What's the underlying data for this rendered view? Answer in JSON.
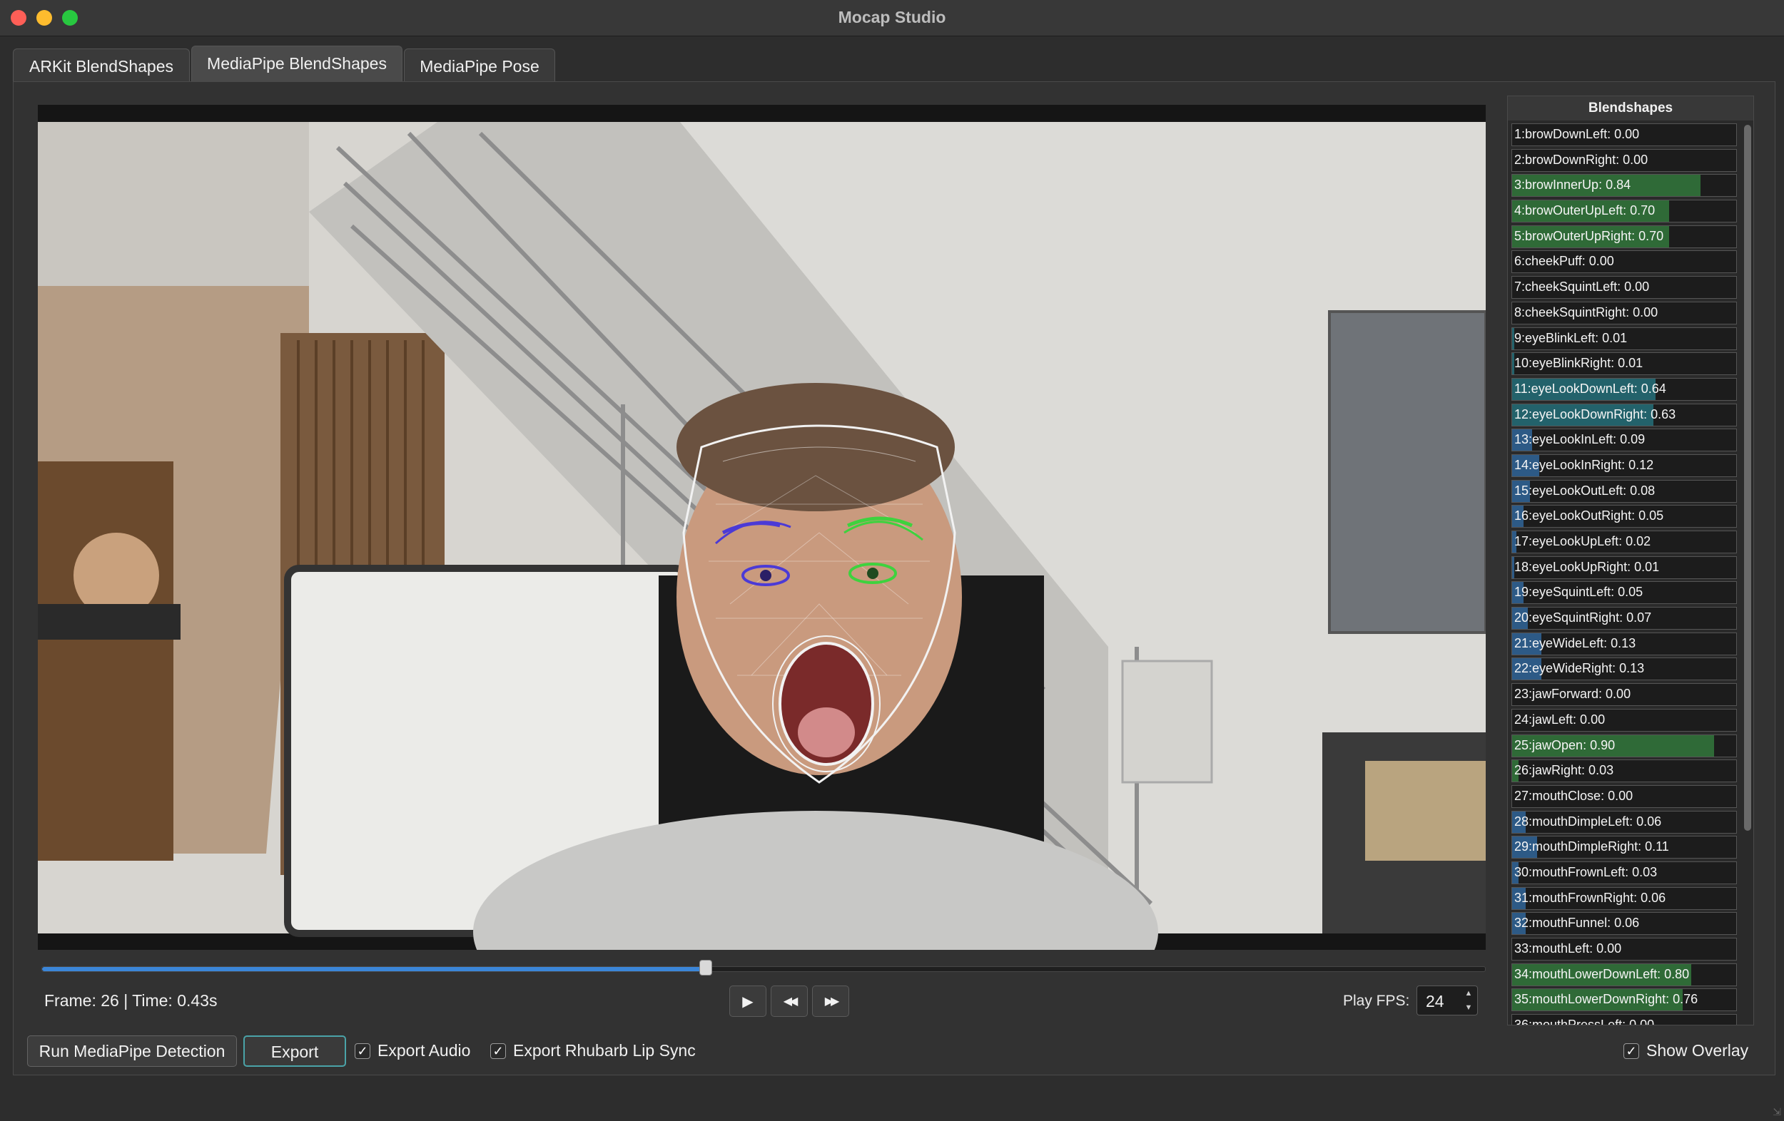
{
  "window": {
    "title": "Mocap Studio"
  },
  "tabs": [
    {
      "label": "ARKit BlendShapes",
      "active": false
    },
    {
      "label": "MediaPipe BlendShapes",
      "active": true
    },
    {
      "label": "MediaPipe Pose",
      "active": false
    }
  ],
  "video": {
    "description_icon": "face-mesh-overlay"
  },
  "timeline": {
    "progress": 0.46
  },
  "status": {
    "frame_label": "Frame: 26 | Time: 0.43s"
  },
  "controls": {
    "play_icon": "play-icon",
    "rewind_icon": "rewind-icon",
    "forward_icon": "fast-forward-icon",
    "fps_label": "Play FPS:",
    "fps_value": "24"
  },
  "actions": {
    "run_label": "Run MediaPipe Detection",
    "export_label": "Export",
    "export_audio_label": "Export Audio",
    "export_audio_checked": true,
    "export_rhubarb_label": "Export Rhubarb Lip Sync",
    "export_rhubarb_checked": true,
    "show_overlay_label": "Show Overlay",
    "show_overlay_checked": true
  },
  "blendshapes": {
    "header": "Blendshapes",
    "colors": {
      "green": "#2f6a37",
      "teal": "#23626b",
      "blue": "#2d5a86"
    },
    "items": [
      {
        "label": "1:browDownLeft: 0.00",
        "value": 0.0,
        "color": "green"
      },
      {
        "label": "2:browDownRight: 0.00",
        "value": 0.0,
        "color": "green"
      },
      {
        "label": "3:browInnerUp: 0.84",
        "value": 0.84,
        "color": "green"
      },
      {
        "label": "4:browOuterUpLeft: 0.70",
        "value": 0.7,
        "color": "green"
      },
      {
        "label": "5:browOuterUpRight: 0.70",
        "value": 0.7,
        "color": "green"
      },
      {
        "label": "6:cheekPuff: 0.00",
        "value": 0.0,
        "color": "green"
      },
      {
        "label": "7:cheekSquintLeft: 0.00",
        "value": 0.0,
        "color": "green"
      },
      {
        "label": "8:cheekSquintRight: 0.00",
        "value": 0.0,
        "color": "green"
      },
      {
        "label": "9:eyeBlinkLeft: 0.01",
        "value": 0.01,
        "color": "teal"
      },
      {
        "label": "10:eyeBlinkRight: 0.01",
        "value": 0.01,
        "color": "teal"
      },
      {
        "label": "11:eyeLookDownLeft: 0.64",
        "value": 0.64,
        "color": "teal"
      },
      {
        "label": "12:eyeLookDownRight: 0.63",
        "value": 0.63,
        "color": "teal"
      },
      {
        "label": "13:eyeLookInLeft: 0.09",
        "value": 0.09,
        "color": "blue"
      },
      {
        "label": "14:eyeLookInRight: 0.12",
        "value": 0.12,
        "color": "blue"
      },
      {
        "label": "15:eyeLookOutLeft: 0.08",
        "value": 0.08,
        "color": "blue"
      },
      {
        "label": "16:eyeLookOutRight: 0.05",
        "value": 0.05,
        "color": "blue"
      },
      {
        "label": "17:eyeLookUpLeft: 0.02",
        "value": 0.02,
        "color": "blue"
      },
      {
        "label": "18:eyeLookUpRight: 0.01",
        "value": 0.01,
        "color": "blue"
      },
      {
        "label": "19:eyeSquintLeft: 0.05",
        "value": 0.05,
        "color": "blue"
      },
      {
        "label": "20:eyeSquintRight: 0.07",
        "value": 0.07,
        "color": "blue"
      },
      {
        "label": "21:eyeWideLeft: 0.13",
        "value": 0.13,
        "color": "blue"
      },
      {
        "label": "22:eyeWideRight: 0.13",
        "value": 0.13,
        "color": "blue"
      },
      {
        "label": "23:jawForward: 0.00",
        "value": 0.0,
        "color": "green"
      },
      {
        "label": "24:jawLeft: 0.00",
        "value": 0.0,
        "color": "green"
      },
      {
        "label": "25:jawOpen: 0.90",
        "value": 0.9,
        "color": "green"
      },
      {
        "label": "26:jawRight: 0.03",
        "value": 0.03,
        "color": "green"
      },
      {
        "label": "27:mouthClose: 0.00",
        "value": 0.0,
        "color": "blue"
      },
      {
        "label": "28:mouthDimpleLeft: 0.06",
        "value": 0.06,
        "color": "blue"
      },
      {
        "label": "29:mouthDimpleRight: 0.11",
        "value": 0.11,
        "color": "blue"
      },
      {
        "label": "30:mouthFrownLeft: 0.03",
        "value": 0.03,
        "color": "blue"
      },
      {
        "label": "31:mouthFrownRight: 0.06",
        "value": 0.06,
        "color": "blue"
      },
      {
        "label": "32:mouthFunnel: 0.06",
        "value": 0.06,
        "color": "blue"
      },
      {
        "label": "33:mouthLeft: 0.00",
        "value": 0.0,
        "color": "green"
      },
      {
        "label": "34:mouthLowerDownLeft: 0.80",
        "value": 0.8,
        "color": "green"
      },
      {
        "label": "35:mouthLowerDownRight: 0.76",
        "value": 0.76,
        "color": "green"
      },
      {
        "label": "36:mouthPressLeft: 0.00",
        "value": 0.0,
        "color": "green"
      }
    ]
  }
}
